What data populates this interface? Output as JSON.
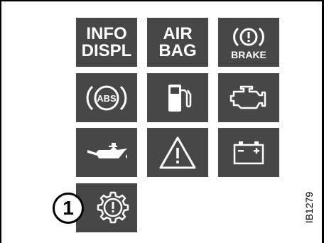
{
  "tiles": {
    "info_display": {
      "line1": "INFO",
      "line2": "DISPL"
    },
    "airbag": {
      "line1": "AIR",
      "line2": "BAG"
    },
    "brake": {
      "symbol": "(!)",
      "label": "BRAKE"
    },
    "abs": {
      "label": "ABS"
    }
  },
  "callout": {
    "number": "1"
  },
  "reference_code": "IB1279",
  "colors": {
    "tile_background": "#474747",
    "icon": "#ffffff",
    "frame": "#000000"
  }
}
